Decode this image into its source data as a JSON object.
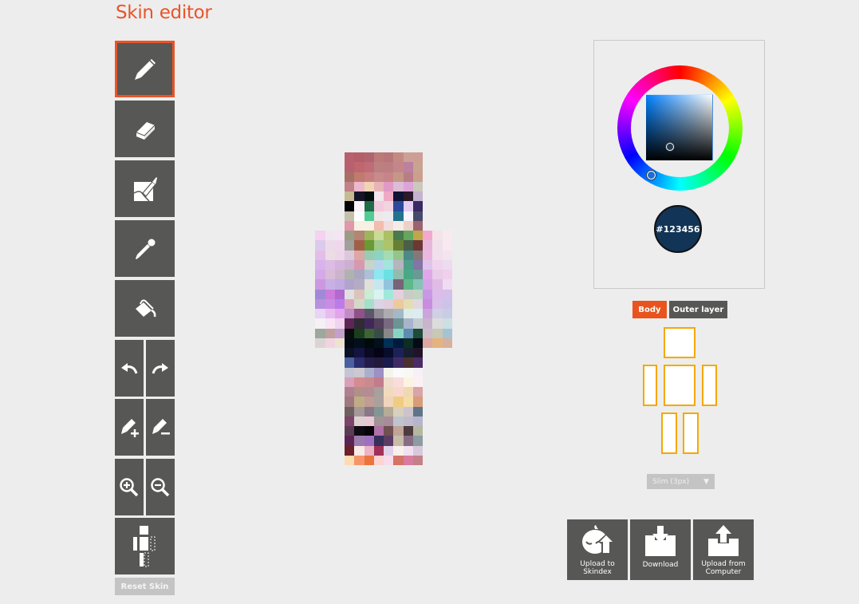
{
  "header": {
    "title": "Skin editor"
  },
  "tools": {
    "pencil": {
      "label": "Pencil",
      "icon": "pencil-icon",
      "active": true
    },
    "eraser": {
      "label": "Eraser",
      "icon": "eraser-icon"
    },
    "brush": {
      "label": "Brush",
      "icon": "brush-icon"
    },
    "eyedropper": {
      "label": "Color picker",
      "icon": "eyedropper-icon"
    },
    "bucket": {
      "label": "Fill bucket",
      "icon": "paint-bucket-icon"
    },
    "undo": {
      "label": "Undo",
      "icon": "undo-icon"
    },
    "redo": {
      "label": "Redo",
      "icon": "redo-icon"
    },
    "lighten": {
      "label": "Lighten",
      "icon": "lighten-icon"
    },
    "darken": {
      "label": "Darken",
      "icon": "darken-icon"
    },
    "zoom_in": {
      "label": "Zoom in",
      "icon": "zoom-in-icon"
    },
    "zoom_out": {
      "label": "Zoom out",
      "icon": "zoom-out-icon"
    },
    "toggle_parts": {
      "label": "Toggle body parts",
      "icon": "body-parts-icon"
    },
    "reset_label": "Reset Skin"
  },
  "color": {
    "hex_label": "#123456",
    "value": "#123456",
    "hue_handle_color": "#1a6fd0"
  },
  "layers": {
    "body_label": "Body",
    "outer_label": "Outer layer",
    "active": "Body"
  },
  "body_parts": [
    "head",
    "left-arm",
    "torso",
    "right-arm",
    "left-leg",
    "right-leg"
  ],
  "arm_model": {
    "selected": "Slim (3px)"
  },
  "actions": {
    "skindex_label_1": "Upload to",
    "skindex_label_2": "Skindex",
    "download_label": "Download",
    "upload_label_1": "Upload from",
    "upload_label_2": "Computer"
  },
  "skin": {
    "head": [
      [
        "#b8606e",
        "#b45e6a",
        "#b06470",
        "#bc7a78",
        "#b8767a",
        "#c48a82",
        "#ccA096",
        "#cc9e94"
      ],
      [
        "#b86070",
        "#c0666e",
        "#c06c78",
        "#bc8080",
        "#bc7e82",
        "#c4868a",
        "#bc80a0",
        "#c8a490"
      ],
      [
        "#a87064",
        "#c07a6e",
        "#c87e80",
        "#c88a8a",
        "#c88488",
        "#c49886",
        "#b87e88",
        "#cc9e8e"
      ],
      [
        "#c08286",
        "#ecb8cc",
        "#f0d4b4",
        "#e8b4b8",
        "#e09ac4",
        "#dcbcd6",
        "#dea4d8",
        "#cbc8bc"
      ],
      [
        "#c6ba92",
        "#161428",
        "#040e0e",
        "#f4e4ec",
        "#eeaac4",
        "#0e1434",
        "#2a1a2a",
        "#c4b2ce"
      ],
      [
        "#040406",
        "#fcf2fa",
        "#206c48",
        "#f2cadc",
        "#f0d4e0",
        "#2a4a9e",
        "#e4cef4",
        "#3a2a64"
      ],
      [
        "#c4c0ac",
        "#fefefe",
        "#52cc94",
        "#efe8e8",
        "#ecebef",
        "#22748e",
        "#f6f4fc",
        "#484a6c"
      ],
      [
        "#e296aa",
        "#f8f0e2",
        "#f8f0e4",
        "#f2bcae",
        "#f2dcdc",
        "#f6ece6",
        "#eed0ca",
        "#9c6270"
      ]
    ],
    "torso": [
      [
        "#9c9c84",
        "#b48474",
        "#a0b45c",
        "#c8dc98",
        "#acc064",
        "#4a7a4e",
        "#64a65e",
        "#bea64a"
      ],
      [
        "#a0a09c",
        "#a06048",
        "#6a9a34",
        "#a0c888",
        "#acc46c",
        "#688034",
        "#4a5e48",
        "#6c3834"
      ],
      [
        "#dcc8dc",
        "#dca8a4",
        "#98ccb4",
        "#8cd4c0",
        "#a4dcb4",
        "#94c48c",
        "#4e8888",
        "#867878"
      ],
      [
        "#ccb0d0",
        "#d898b0",
        "#c8d4c8",
        "#b8d4ec",
        "#a4e4e0",
        "#b6b4bc",
        "#4e9e8c",
        "#8474a8"
      ],
      [
        "#b0b2b0",
        "#aaa8c0",
        "#acc0d8",
        "#8ce8f0",
        "#6ce0e4",
        "#94bcac",
        "#4aa888",
        "#6a9a94"
      ],
      [
        "#b0a4cc",
        "#b4acc4",
        "#e0e0d8",
        "#c8e6f0",
        "#94c4dc",
        "#786478",
        "#5eb888",
        "#84c4b4"
      ],
      [
        "#e0e0e0",
        "#dcc4bc",
        "#c8ecd4",
        "#d8f4f0",
        "#a0e8dc",
        "#e4d0dc",
        "#c8ccc4",
        "#c0d4c4"
      ],
      [
        "#dca8c0",
        "#d4d8c8",
        "#a4e0c8",
        "#dcd4e4",
        "#e0cedc",
        "#ecca9e",
        "#e4dcb4",
        "#e0d8e0"
      ],
      [
        "#c08cc4",
        "#905088",
        "#5c5668",
        "#908c98",
        "#acacae",
        "#a4b8c8",
        "#dcece8",
        "#dcecf0"
      ],
      [
        "#5e2656",
        "#302a34",
        "#40285a",
        "#52405c",
        "#786880",
        "#6c9494",
        "#a8b4cc",
        "#c4ccd0"
      ],
      [
        "#080c0c",
        "#1a3e1e",
        "#3e6436",
        "#3a4c48",
        "#888888",
        "#88d4c4",
        "#5e8cb0",
        "#1e4c34"
      ],
      [
        "#040a14",
        "#02101c",
        "#000a0a",
        "#02101c",
        "#003054",
        "#001a3c",
        "#0c2e24",
        "#040a16"
      ]
    ],
    "left_arm": [
      [
        "#f4d2f0",
        "#f0e6f0",
        "#f4e4f4"
      ],
      [
        "#dccaec",
        "#ecdaea",
        "#f0d8ec"
      ],
      [
        "#e4bee8",
        "#ecdce4",
        "#ecd6e8"
      ],
      [
        "#d8b4ec",
        "#dcbce4",
        "#d4b4dc"
      ],
      [
        "#d4aae8",
        "#d8bcd8",
        "#ccb4cc"
      ],
      [
        "#cc98e0",
        "#c8b0e4",
        "#c0ace0"
      ],
      [
        "#a08ad8",
        "#cc7cdc",
        "#b06ad0"
      ],
      [
        "#b890e0",
        "#c88ce4",
        "#bc7ce8"
      ],
      [
        "#e8d4f4",
        "#e8bcf0",
        "#e4a4ec"
      ],
      [
        "#f4f0f4",
        "#f8e4f4",
        "#f0d4f0"
      ],
      [
        "#9ca89c",
        "#c0a0a0",
        "#c4a0cc"
      ],
      [
        "#dcd4d4",
        "#f0d4e0",
        "#ece4d0"
      ]
    ],
    "right_arm": [
      [
        "#f4a8d0",
        "#f4e4e8",
        "#f8eaf0"
      ],
      [
        "#e8b8dc",
        "#f0e0ec",
        "#f8e8f0"
      ],
      [
        "#ecb8e0",
        "#f0e0ec",
        "#f4e4f0"
      ],
      [
        "#e0c4ec",
        "#f0d4ec",
        "#ecdcf0"
      ],
      [
        "#e0a8e8",
        "#e8cce8",
        "#f0d0ec"
      ],
      [
        "#d4a4e8",
        "#e0bce4",
        "#f0dcf0"
      ],
      [
        "#c898e4",
        "#dcbce8",
        "#d4c0e8"
      ],
      [
        "#c88ce0",
        "#d8c0e8",
        "#ccc4e8"
      ],
      [
        "#cca4dc",
        "#d0d0e4",
        "#c8cce4"
      ],
      [
        "#c8b4cc",
        "#dcdcdc",
        "#cce0e4"
      ],
      [
        "#ccbcc8",
        "#c8c8b4",
        "#a4c4d4"
      ],
      [
        "#dca8a0",
        "#e4b480",
        "#d8b0a0"
      ]
    ],
    "legs": [
      [
        "#0c1024",
        "#141440",
        "#0a0a20",
        "#040416",
        "#0a0c2c",
        "#1c2258",
        "#161e30",
        "#221428"
      ],
      [
        "#4c60a0",
        "#2a2c6c",
        "#241c48",
        "#221a3c",
        "#1a1c4c",
        "#402c64",
        "#4a3030",
        "#4a2c68"
      ],
      [
        "#c4c4d4",
        "#ccc8d0",
        "#aab0cc",
        "#9c90c4",
        "#f4f4ec",
        "#fafafa",
        "#f8f8f4",
        "#f8f0f8"
      ],
      [
        "#d8a0b8",
        "#d48c90",
        "#c88c90",
        "#c47c8c",
        "#f0dccc",
        "#fadcdc",
        "#fcf4e0",
        "#fcf0f4"
      ],
      [
        "#b08090",
        "#b09088",
        "#b48c94",
        "#a8a09c",
        "#f0dcbc",
        "#f8d8cc",
        "#f0d8b4",
        "#d8a4a8"
      ],
      [
        "#a07880",
        "#c0ac84",
        "#c09c94",
        "#aca09c",
        "#f0d4bc",
        "#f0cc80",
        "#f4dca4",
        "#d89c78"
      ],
      [
        "#6c6060",
        "#a49898",
        "#887888",
        "#849694",
        "#b4ac94",
        "#d8d0bc",
        "#ccc4cc",
        "#607488"
      ],
      [
        "#7c4468",
        "#dcd0d0",
        "#e8c8d4",
        "#a09494",
        "#a88c9c",
        "#c0c4cc",
        "#c0bccc",
        "#b8b4d0"
      ],
      [
        "#5c3c54",
        "#100c14",
        "#080408",
        "#b070a8",
        "#705050",
        "#c0a498",
        "#4c3c40",
        "#b4b8a0"
      ],
      [
        "#5c2454",
        "#9c7cac",
        "#a070c0",
        "#34305c",
        "#5c3c64",
        "#c8bca8",
        "#886c84",
        "#8c9ca0"
      ],
      [
        "#6c2028",
        "#f8ece8",
        "#ecb4c4",
        "#a03058",
        "#e0d0e8",
        "#f8f0ec",
        "#f0e0f0",
        "#d8c8dc"
      ],
      [
        "#fcdcb0",
        "#f8946c",
        "#ec743c",
        "#fcd4d4",
        "#f8dcea",
        "#d47464",
        "#d87ca0",
        "#c48088"
      ]
    ]
  }
}
